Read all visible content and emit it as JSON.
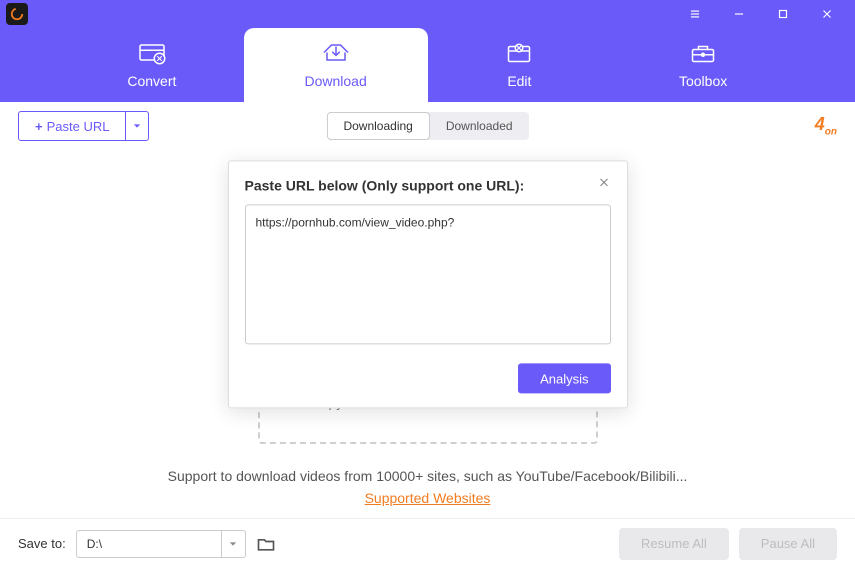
{
  "nav": {
    "convert": "Convert",
    "download": "Download",
    "edit": "Edit",
    "toolbox": "Toolbox"
  },
  "toolbar": {
    "paste_label": "Paste URL",
    "seg_downloading": "Downloading",
    "seg_downloaded": "Downloaded"
  },
  "main": {
    "dropzone_text": "Copy URL and click here to download",
    "support_text": "Support to download videos from 10000+ sites, such as YouTube/Facebook/Bilibili...",
    "support_link": "Supported Websites"
  },
  "dialog": {
    "title": "Paste URL below (Only support one URL):",
    "url_value": "https://pornhub.com/view_video.php?",
    "analysis_label": "Analysis"
  },
  "footer": {
    "saveto_label": "Save to:",
    "saveto_value": "D:\\",
    "resume_label": "Resume All",
    "pause_label": "Pause All"
  }
}
